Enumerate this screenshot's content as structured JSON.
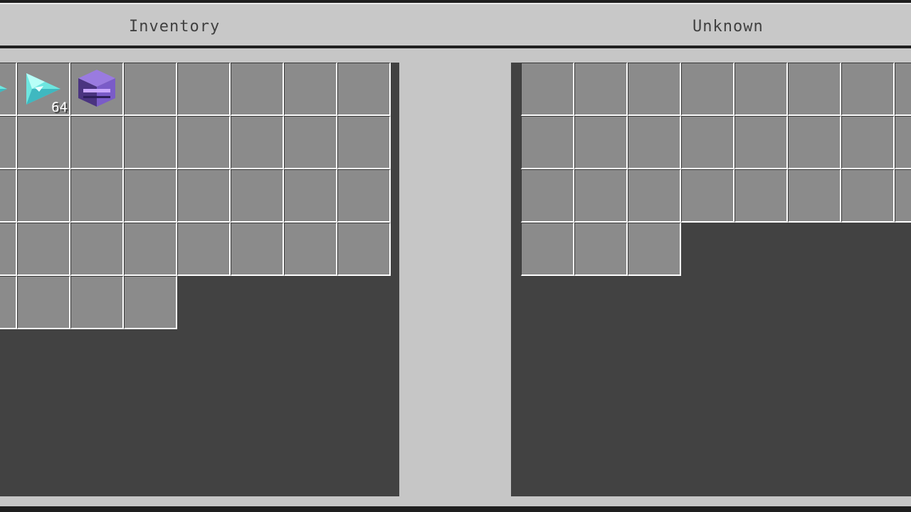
{
  "header": {
    "inventory_title": "Inventory",
    "container_title": "Unknown"
  },
  "inventory": {
    "rows": [
      [
        {
          "item": "prismarine-crystals-icon",
          "count": "",
          "marker": true
        },
        {
          "item": "prismarine-crystals-icon",
          "count": "64"
        },
        {
          "item": "shulker-box-icon",
          "count": ""
        },
        {},
        {},
        {},
        {},
        {}
      ],
      [
        {},
        {},
        {},
        {},
        {},
        {},
        {},
        {}
      ],
      [
        {},
        {},
        {},
        {},
        {},
        {},
        {},
        {}
      ],
      [
        {},
        {},
        {},
        {},
        {},
        {},
        {},
        {}
      ],
      [
        {},
        {},
        {},
        {}
      ]
    ]
  },
  "container": {
    "rows": [
      [
        {},
        {},
        {},
        {},
        {},
        {},
        {},
        {}
      ],
      [
        {},
        {},
        {},
        {},
        {},
        {},
        {},
        {}
      ],
      [
        {},
        {},
        {},
        {},
        {},
        {},
        {},
        {}
      ],
      [
        {},
        {},
        {}
      ]
    ]
  },
  "colors": {
    "background": "#c6c6c6",
    "panel": "#424242",
    "slot": "#8b8b8b",
    "slot_highlight": "#ffffff",
    "item_cyan": "#6ee6e0",
    "item_purple": "#7a5cc8"
  }
}
